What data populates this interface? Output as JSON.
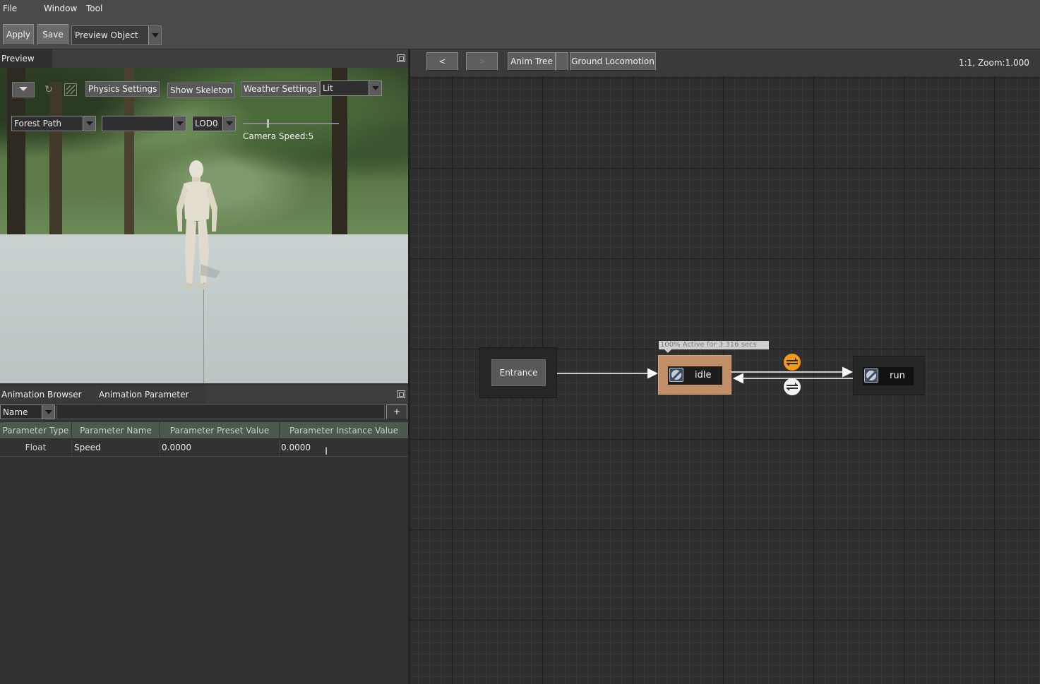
{
  "menu": {
    "file": "File",
    "window": "Window",
    "tool": "Tool"
  },
  "toolbar": {
    "apply": "Apply",
    "save": "Save",
    "preview_object": "Preview Object"
  },
  "preview_panel": {
    "tab": "Preview",
    "physics_settings": "Physics Settings",
    "show_skeleton": "Show Skeleton",
    "weather_settings": "Weather Settings",
    "lit_mode": "Lit",
    "environment": "Forest Path",
    "secondary_select": "",
    "lod": "LOD0",
    "camera_speed": "Camera Speed:5"
  },
  "bottom_panel": {
    "tabs": [
      "Animation Browser",
      "Animation Parameter"
    ],
    "filter_field": "Name",
    "add_button": "+",
    "columns": [
      "Parameter Type",
      "Parameter Name",
      "Parameter Preset Value",
      "Parameter Instance Value"
    ],
    "rows": [
      [
        "Float",
        "Speed",
        "0.0000",
        "0.0000"
      ]
    ]
  },
  "graph": {
    "back": "<",
    "forward": ">",
    "breadcrumb": [
      "Anim Tree",
      "",
      "Ground Locomotion"
    ],
    "zoom_label": "1:1, Zoom:1.000",
    "entrance": "Entrance",
    "idle_status": "100% Active for 3.316 secs",
    "idle": "idle",
    "run": "run"
  },
  "colors": {
    "active_state": "#c18e67",
    "transition_active": "#f29a1c",
    "grid_bg": "#2e2e2e"
  }
}
